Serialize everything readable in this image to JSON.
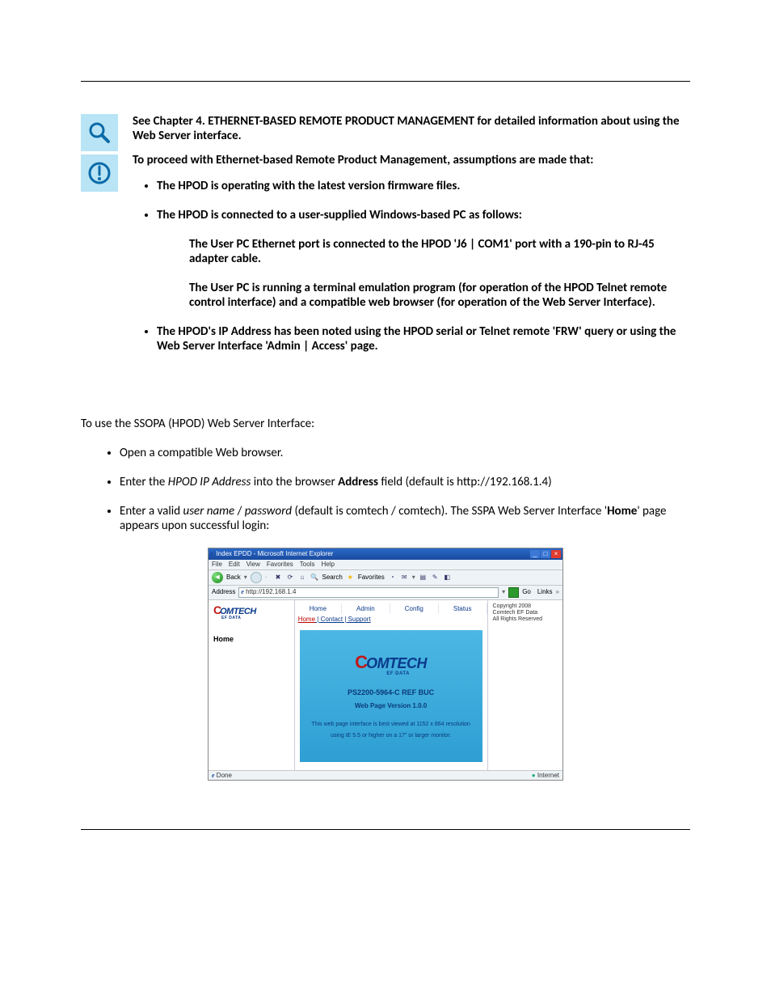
{
  "note": {
    "line1": "See Chapter 4. ETHERNET-BASED REMOTE PRODUCT MANAGEMENT for detailed information about using the Web Server interface.",
    "line2": "To proceed with Ethernet-based Remote Product Management, assumptions are made that:",
    "bullets": [
      "The HPOD is operating with the latest version firmware files.",
      "The HPOD is connected to a user-supplied Windows-based PC as follows:"
    ],
    "sub": [
      "The User PC Ethernet port is connected to the HPOD 'J6 | COM1' port with a 190-pin to RJ-45 adapter cable.",
      "The User PC is running a terminal emulation program (for operation of the HPOD Telnet remote control interface) and a compatible web browser (for operation of the Web Server Interface)."
    ],
    "bullet3": "The HPOD's IP Address has been noted using the HPOD serial or Telnet remote 'FRW' query or using the Web Server Interface 'Admin | Access' page."
  },
  "body": {
    "intro": "To use the SSOPA (HPOD) Web Server Interface:",
    "steps": {
      "s1": "Open a compatible Web browser.",
      "s2_pre": "Enter the ",
      "s2_ital": "HPOD IP Address",
      "s2_mid": " into the browser ",
      "s2_bold": "Address",
      "s2_post": " field (default is http://192.168.1.4)",
      "s3_pre": "Enter a valid ",
      "s3_ital1": "user name",
      "s3_sep": " / ",
      "s3_ital2": "password",
      "s3_mid": " (default is comtech / comtech). The SSPA Web Server Interface '",
      "s3_bold": "Home",
      "s3_post": "' page appears upon successful login:"
    }
  },
  "browser": {
    "title": "Index EPDD - Microsoft Internet Explorer",
    "menus": [
      "File",
      "Edit",
      "View",
      "Favorites",
      "Tools",
      "Help"
    ],
    "toolbar": {
      "back": "Back",
      "search": "Search",
      "favorites": "Favorites"
    },
    "addr_label": "Address",
    "addr_value": "http://192.168.1.4",
    "go": "Go",
    "links": "Links",
    "tabs": [
      "Home",
      "Admin",
      "Config",
      "Status"
    ],
    "sub_home": "Home",
    "sub_rest": " | Contact | Support",
    "side_label": "Home",
    "right": [
      "Copyright 2008",
      "Comtech EF Data",
      "All Rights Reserved"
    ],
    "panel": {
      "line1": "PS2200-5964-C REF BUC",
      "line2": "Web Page Version 1.0.0",
      "small1": "This web page interface is best viewed at 1152 x 864 resolution",
      "small2": "using IE 5.5 or higher on a 17\" or larger monitor."
    },
    "status_left": "Done",
    "status_right": "Internet",
    "logo_text": "OMTECH",
    "logo_sub": "EF DATA"
  }
}
